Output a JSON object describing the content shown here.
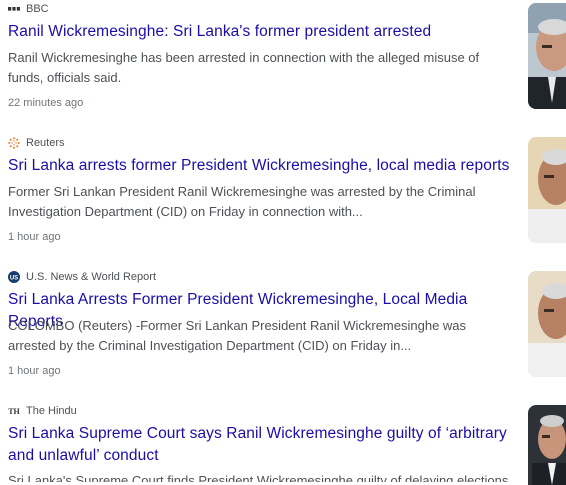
{
  "articles": [
    {
      "source": "BBC",
      "source_icon": "bbc-logo-icon",
      "title": "Ranil Wickremesinghe: Sri Lanka's former president arrested",
      "snippet": "Ranil Wickremesinghe has been arrested in connection with the alleged misuse of funds, officials said.",
      "time": "22 minutes ago"
    },
    {
      "source": "Reuters",
      "source_icon": "reuters-logo-icon",
      "title": "Sri Lanka arrests former President Wickremesinghe, local media reports",
      "snippet": "Former Sri Lankan President Ranil Wickremesinghe was arrested by the Criminal Investigation Department (CID) on Friday in connection with...",
      "time": "1 hour ago"
    },
    {
      "source": "U.S. News & World Report",
      "source_icon": "usnews-logo-icon",
      "title": "Sri Lanka Arrests Former President Wickremesinghe, Local Media Reports",
      "snippet": "COLOMBO (Reuters) -Former Sri Lankan President Ranil Wickremesinghe was arrested by the Criminal Investigation Department (CID) on Friday in...",
      "time": "1 hour ago"
    },
    {
      "source": "The Hindu",
      "source_icon": "the-hindu-logo-icon",
      "title": "Sri Lanka Supreme Court says Ranil Wickremesinghe guilty of ‘arbitrary and unlawful’ conduct",
      "snippet": "Sri Lanka's Supreme Court finds President Wickremesinghe guilty of delaying elections"
    }
  ],
  "icons": {
    "usnews_letters": "US",
    "hindu_letters": "TH"
  },
  "colors": {
    "title_link": "#1a0dab",
    "snippet_text": "#4d5156",
    "reuters_orange": "#f07a28"
  }
}
